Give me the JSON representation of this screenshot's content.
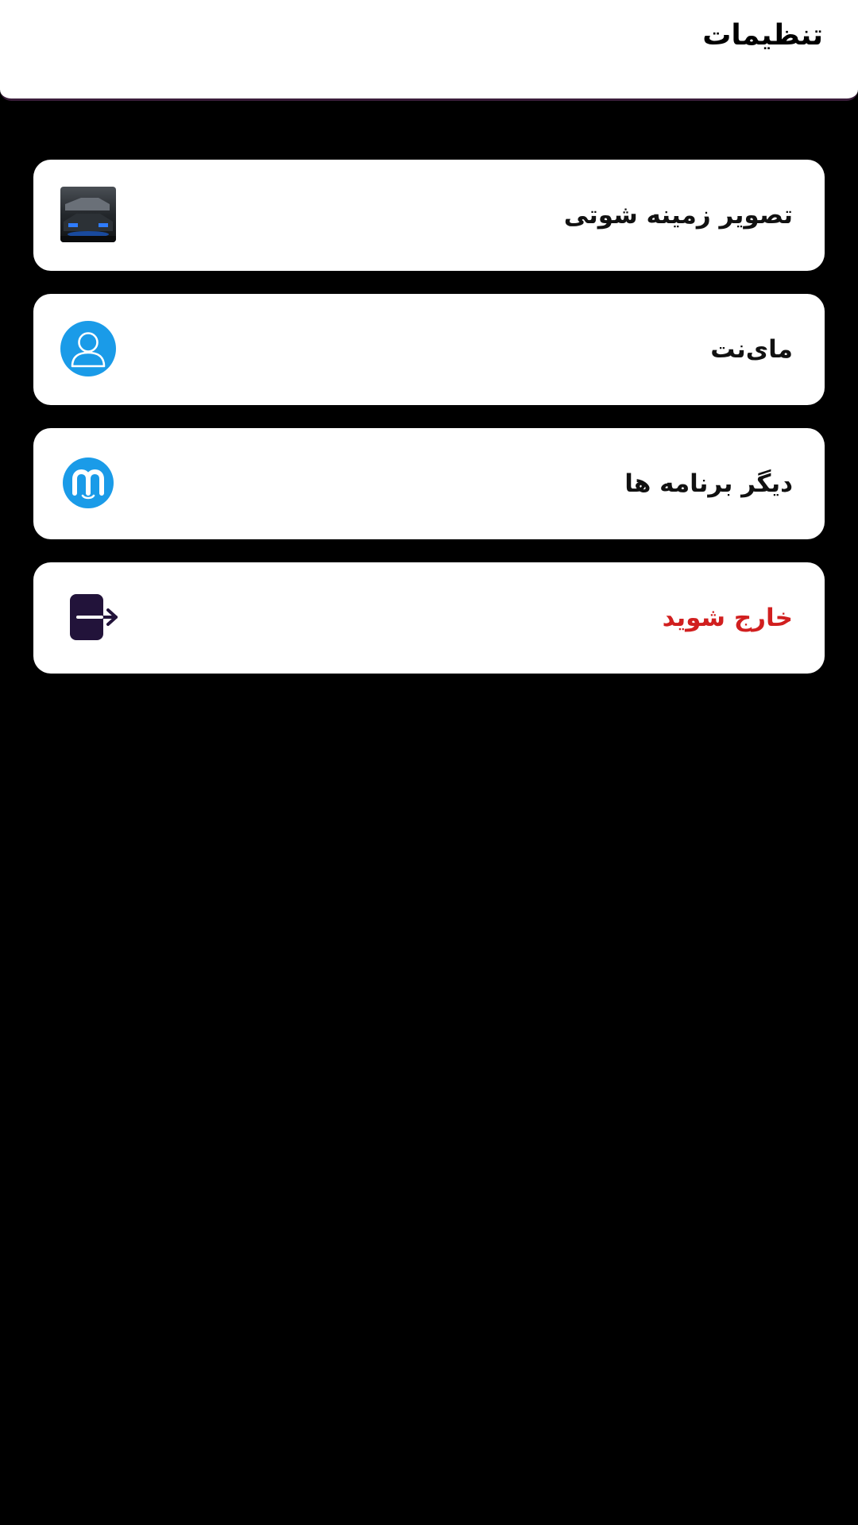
{
  "header": {
    "title": "تنظیمات"
  },
  "menu": {
    "items": [
      {
        "label": "تصویر زمینه شوتی",
        "icon": "wallpaper-thumbnail"
      },
      {
        "label": "مای‌نت",
        "icon": "user-icon"
      },
      {
        "label": "دیگر برنامه ها",
        "icon": "myket-logo-icon"
      },
      {
        "label": "خارج شوید",
        "icon": "logout-icon"
      }
    ]
  },
  "colors": {
    "background": "#000000",
    "card": "#ffffff",
    "accent_blue": "#1a9be8",
    "danger": "#d11f1f",
    "logout_icon": "#22133a"
  }
}
